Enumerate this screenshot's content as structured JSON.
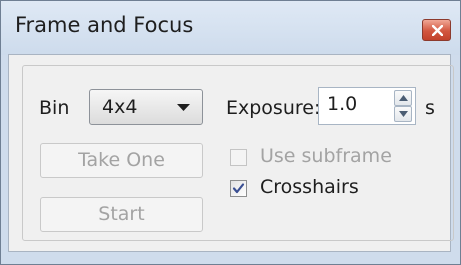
{
  "window": {
    "title": "Frame and Focus"
  },
  "bin": {
    "label": "Bin",
    "selected": "4x4"
  },
  "exposure": {
    "label": "Exposure:",
    "value": "1.0",
    "unit": "s"
  },
  "buttons": {
    "take_one": "Take One",
    "start": "Start"
  },
  "options": {
    "use_subframe": {
      "label": "Use subframe",
      "checked": false,
      "enabled": false
    },
    "crosshairs": {
      "label": "Crosshairs",
      "checked": true,
      "enabled": true
    }
  },
  "icons": {
    "close": "close-icon",
    "dropdown": "chevron-down-icon",
    "spin_up": "spin-up-icon",
    "spin_down": "spin-down-icon",
    "check": "checkmark-icon"
  },
  "colors": {
    "close_button": "#d2563f",
    "check_mark": "#3a4f92",
    "disabled_text": "#a3a3a3"
  }
}
